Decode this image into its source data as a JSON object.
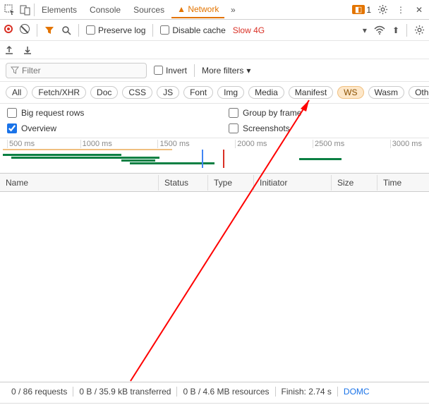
{
  "topbar": {
    "tabs": [
      "Elements",
      "Console",
      "Sources",
      "Network"
    ],
    "activeTab": "Network",
    "issuesCount": "1"
  },
  "toolbar": {
    "preserveLog": "Preserve log",
    "disableCache": "Disable cache",
    "throttle": "Slow 4G"
  },
  "filter": {
    "placeholder": "Filter",
    "invert": "Invert",
    "more": "More filters"
  },
  "pills": [
    "All",
    "Fetch/XHR",
    "Doc",
    "CSS",
    "JS",
    "Font",
    "Img",
    "Media",
    "Manifest",
    "WS",
    "Wasm",
    "Other"
  ],
  "activePill": "WS",
  "options": {
    "bigRows": "Big request rows",
    "overview": "Overview",
    "groupByFrame": "Group by frame",
    "screenshots": "Screenshots"
  },
  "ticks": [
    "500 ms",
    "1000 ms",
    "1500 ms",
    "2000 ms",
    "2500 ms",
    "3000 ms"
  ],
  "columns": {
    "name": "Name",
    "status": "Status",
    "type": "Type",
    "initiator": "Initiator",
    "size": "Size",
    "time": "Time"
  },
  "status": {
    "requests": "0 / 86 requests",
    "transferred": "0 B / 35.9 kB transferred",
    "resources": "0 B / 4.6 MB resources",
    "finish": "Finish: 2.74 s",
    "dom": "DOMC"
  }
}
